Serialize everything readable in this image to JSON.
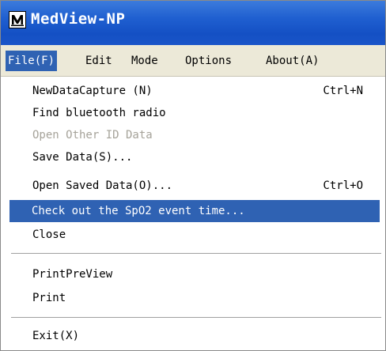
{
  "window": {
    "title": "MedView-NP",
    "icon": "medview-app-icon"
  },
  "menubar": {
    "items": [
      {
        "label": "File(F)",
        "active": true
      },
      {
        "label": "Edit"
      },
      {
        "label": "Mode"
      },
      {
        "label": "Options"
      },
      {
        "label": "About(A)"
      }
    ]
  },
  "file_menu": {
    "items": [
      {
        "label": "NewDataCapture (N)",
        "shortcut": "Ctrl+N"
      },
      {
        "label": "Find bluetooth radio"
      },
      {
        "label": "Open Other ID Data",
        "disabled": true
      },
      {
        "label": "Save Data(S)..."
      },
      {
        "label": "Open Saved Data(O)...",
        "shortcut": "Ctrl+O"
      },
      {
        "label": "Check out the SpO2 event time...",
        "highlighted": true
      },
      {
        "label": "Close"
      },
      {
        "label": "PrintPreView"
      },
      {
        "label": "Print"
      },
      {
        "label": "Exit(X)"
      }
    ]
  },
  "colors": {
    "titlebar": "#1f5fd0",
    "menubar_bg": "#ece9d8",
    "highlight": "#2f62b3",
    "disabled_text": "#a6a39a"
  }
}
